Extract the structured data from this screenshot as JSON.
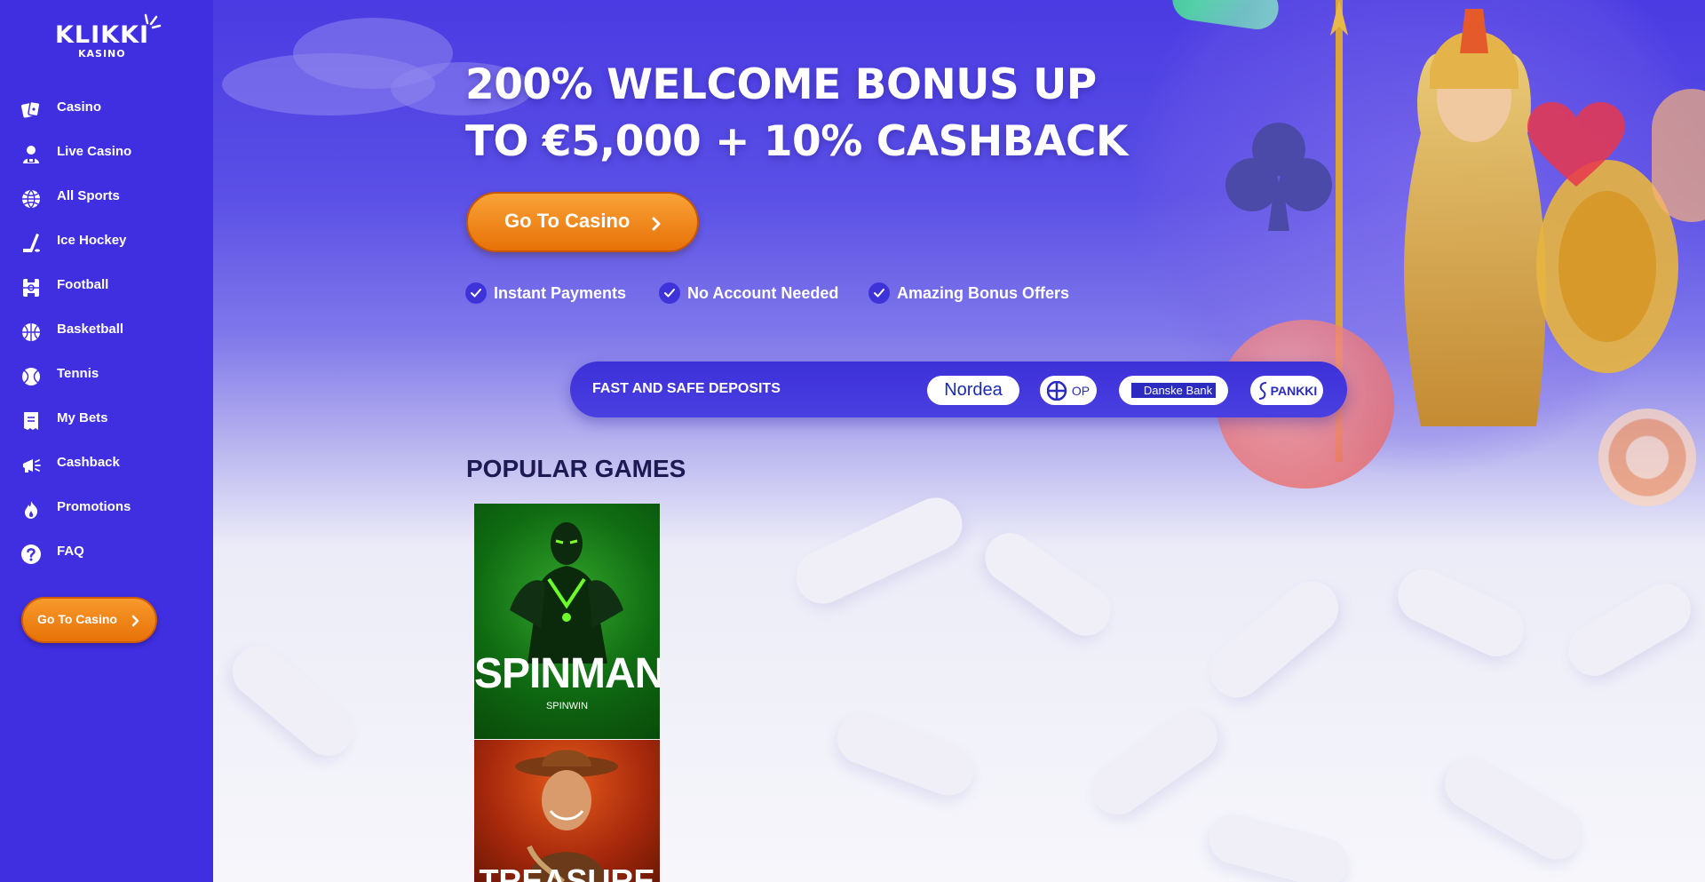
{
  "brand": {
    "logo_main": "KLIKKI",
    "logo_sub": "KASINO"
  },
  "sidebar": {
    "items": [
      {
        "label": "Casino",
        "icon": "cards-icon"
      },
      {
        "label": "Live Casino",
        "icon": "dealer-icon"
      },
      {
        "label": "All Sports",
        "icon": "globe-ball-icon"
      },
      {
        "label": "Ice Hockey",
        "icon": "hockey-stick-icon"
      },
      {
        "label": "Football",
        "icon": "football-pitch-icon"
      },
      {
        "label": "Basketball",
        "icon": "basketball-icon"
      },
      {
        "label": "Tennis",
        "icon": "tennis-ball-icon"
      },
      {
        "label": "My Bets",
        "icon": "bet-slip-icon"
      },
      {
        "label": "Cashback",
        "icon": "megaphone-icon"
      },
      {
        "label": "Promotions",
        "icon": "flame-icon"
      },
      {
        "label": "FAQ",
        "icon": "question-icon"
      }
    ],
    "cta_label": "Go To Casino"
  },
  "hero": {
    "title_line1": "200% WELCOME BONUS UP",
    "title_line2": "TO €5,000 + 10% CASHBACK",
    "cta_label": "Go To Casino",
    "features": [
      "Instant Payments",
      "No Account Needed",
      "Amazing Bonus Offers"
    ]
  },
  "deposits": {
    "label": "FAST AND SAFE DEPOSITS",
    "banks": [
      "Nordea",
      "OP",
      "Danske Bank",
      "PANKKI"
    ]
  },
  "popular": {
    "title": "POPULAR GAMES",
    "games": [
      {
        "title": "SPINMAN",
        "provider": "SPINWIN"
      },
      {
        "title": "TREASURE",
        "provider": ""
      }
    ]
  },
  "colors": {
    "sidebar_bg": "#3f2fe0",
    "accent_orange": "#f28a1e",
    "hero_top": "#4a3be2",
    "heading_dark": "#1c1a52"
  }
}
